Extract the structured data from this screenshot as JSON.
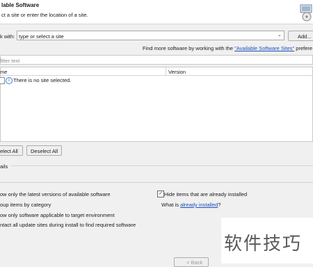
{
  "header": {
    "title": "lable Software",
    "subtitle": "ct a site or enter the location of a site."
  },
  "work_with": {
    "label": "k with:",
    "placeholder": "type or select a site",
    "add_label": "Add..."
  },
  "find_more": {
    "prefix": "Find more software by working with the ",
    "link": "\"Available Software Sites\"",
    "suffix": " prefere"
  },
  "filter": {
    "placeholder": "filter text"
  },
  "table": {
    "columns": [
      "me",
      "Version"
    ],
    "message": "There is no site selected."
  },
  "buttons": {
    "select_all": "elect All",
    "deselect_all": "Deselect All"
  },
  "details": {
    "label": "ails"
  },
  "options": {
    "latest_versions": "ow only the latest versions of available software",
    "group_category": "oup items by category",
    "applicable_target": "ow only software applicable to target environment",
    "contact_sites": "ntact all update sites during install to find required software",
    "hide_installed": "Hide items that are already installed",
    "what_is_prefix": "What is ",
    "what_is_link": "already installed",
    "what_is_suffix": "?"
  },
  "footer": {
    "back_label": "< Back"
  },
  "watermark": "软件技巧",
  "colors": {
    "link": "#1a4fb8",
    "background": "#f0f0f0",
    "accent": "#3b7fd9"
  },
  "icons": [
    "software-install-icon",
    "info-icon",
    "chevron-down-icon",
    "checkbox-icon"
  ]
}
